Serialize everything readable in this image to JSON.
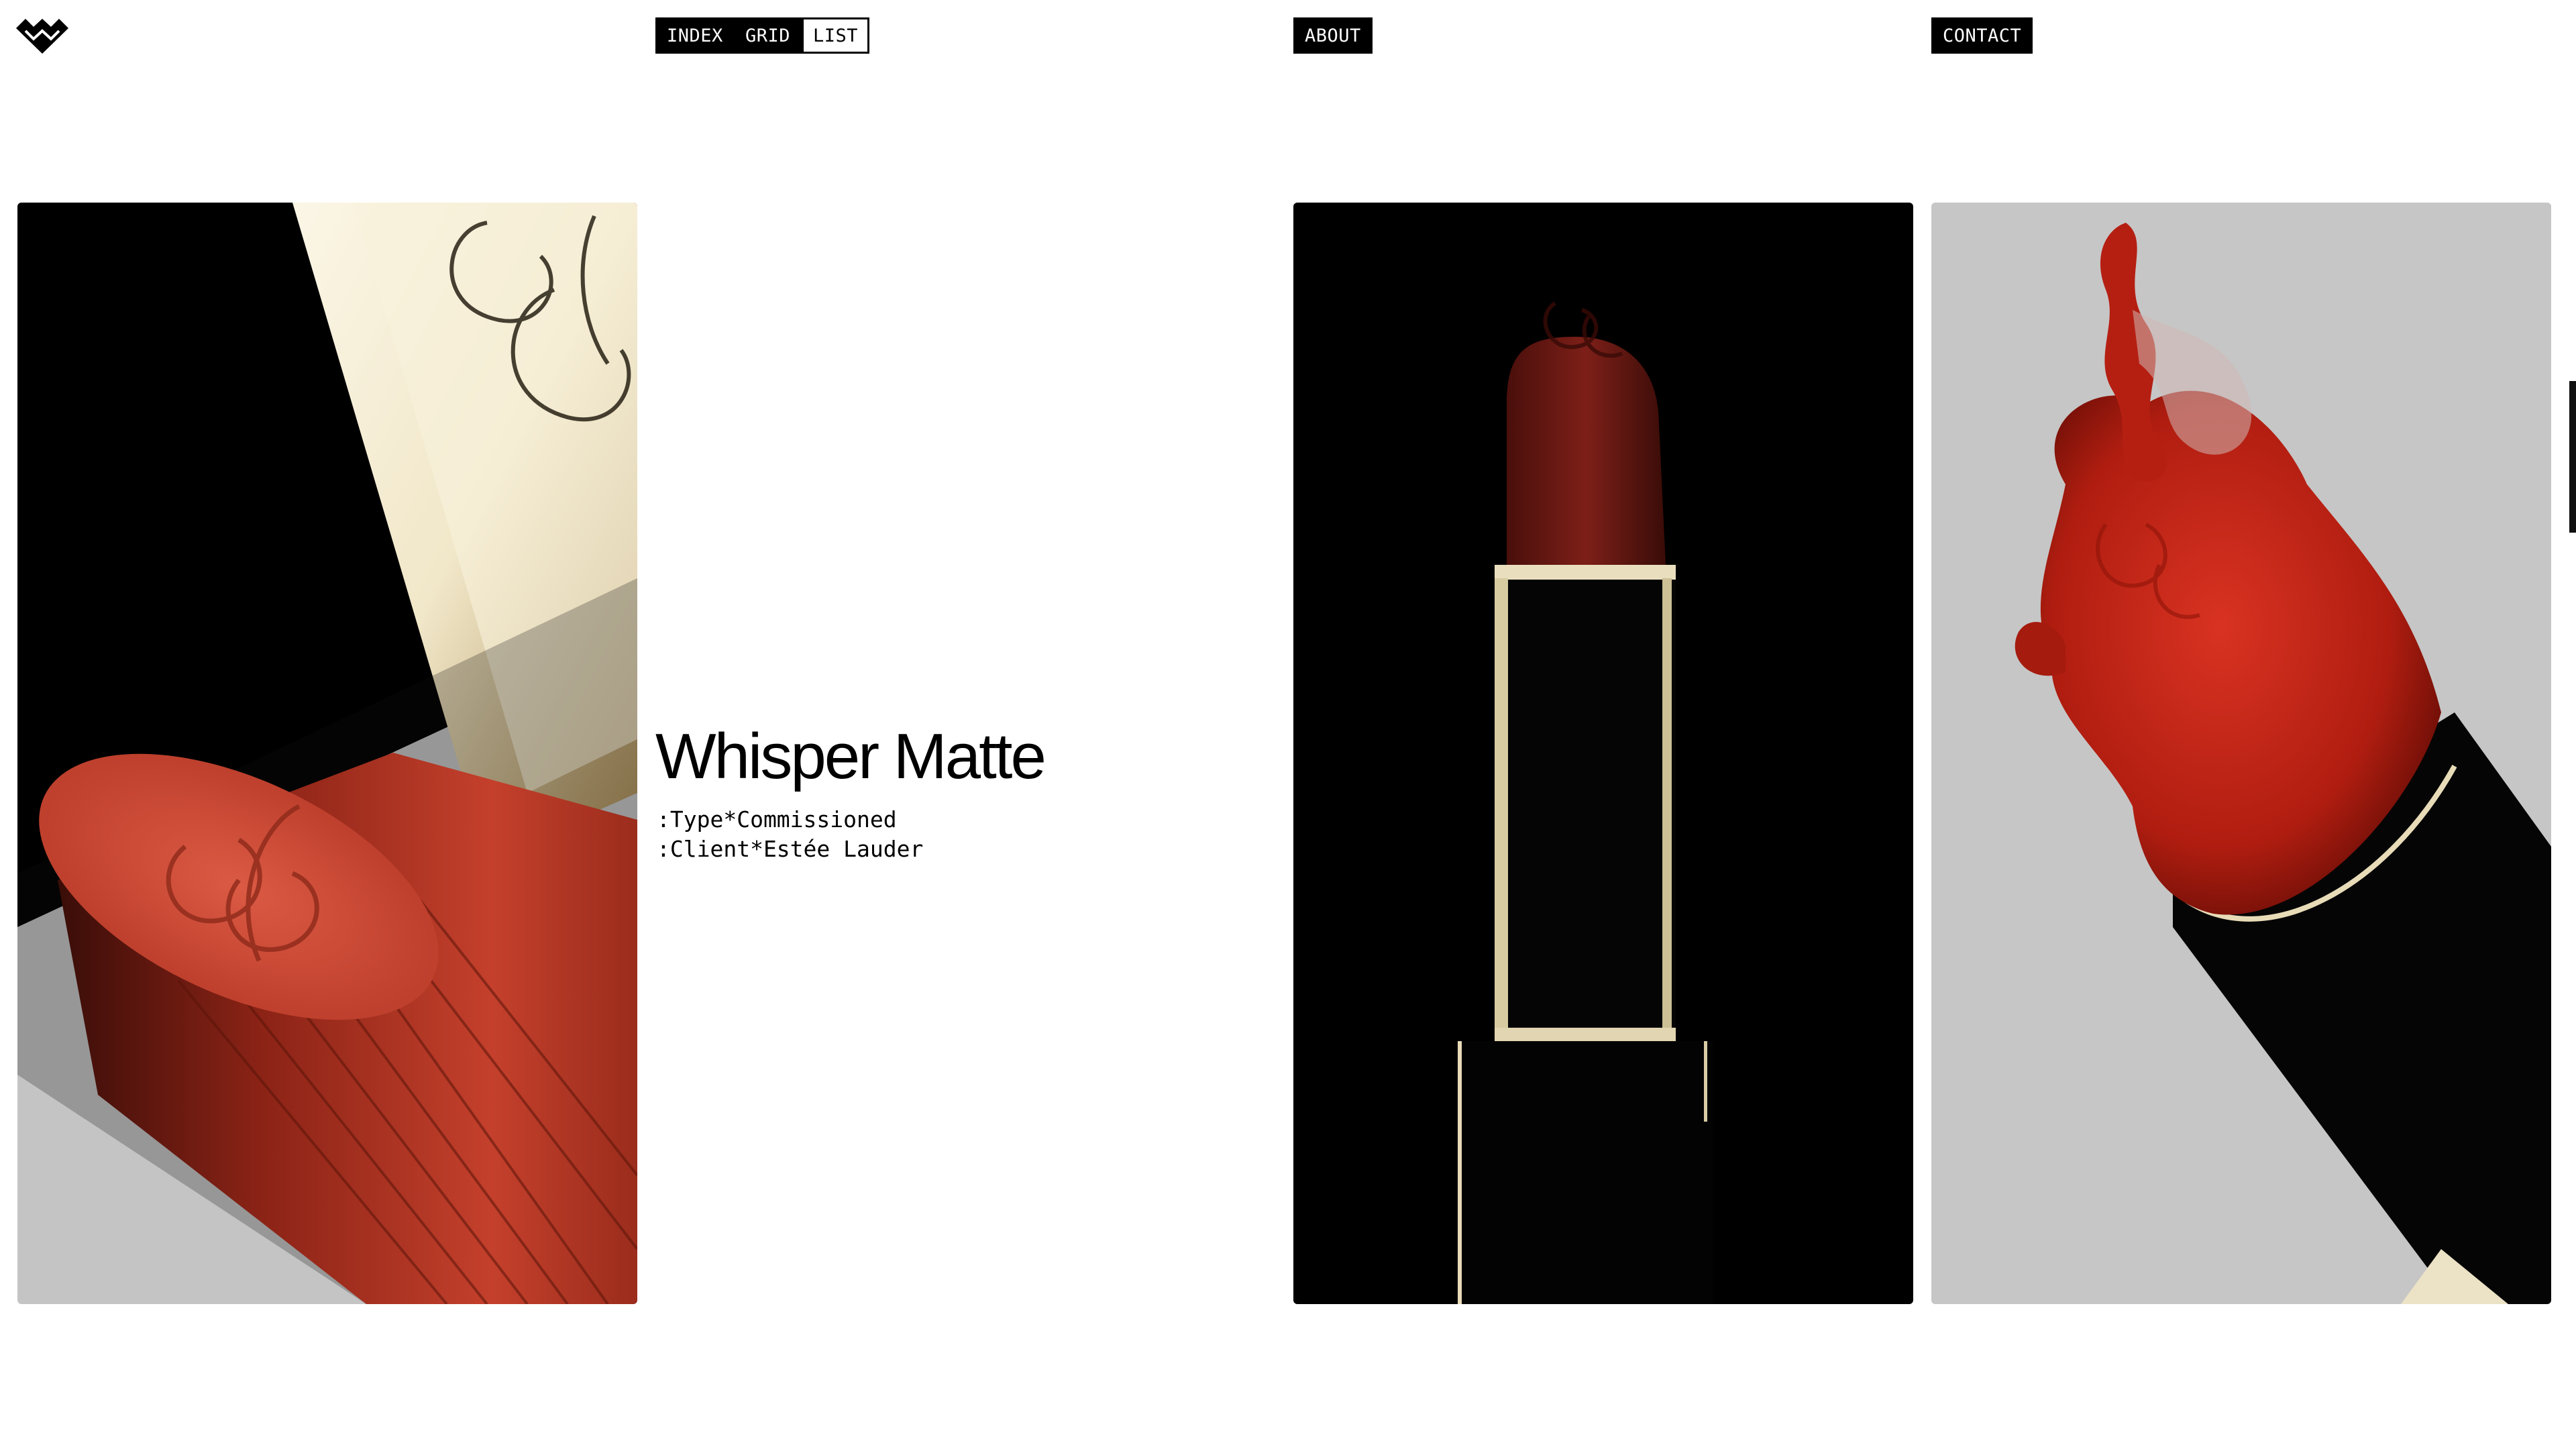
{
  "header": {
    "logo_icon": "brand-mark-icon",
    "nav": {
      "index_label": "INDEX",
      "grid_label": "GRID",
      "list_label": "LIST",
      "about_label": "ABOUT",
      "contact_label": "CONTACT"
    }
  },
  "project": {
    "title": "Whisper Matte",
    "type_line": ":Type*Commissioned",
    "client_line": ":Client*Estée Lauder"
  },
  "gallery": {
    "images": [
      {
        "subject": "red-lipstick-tip-closeup",
        "background": "#c4c4c4"
      },
      {
        "subject": "lipstick-in-dark-case",
        "background": "#000000"
      },
      {
        "subject": "melting-red-lipstick",
        "background": "#c6c6c6"
      }
    ]
  },
  "colors": {
    "lipstick_red": "#c2402e",
    "gold": "#efe6cc",
    "black": "#000000"
  }
}
